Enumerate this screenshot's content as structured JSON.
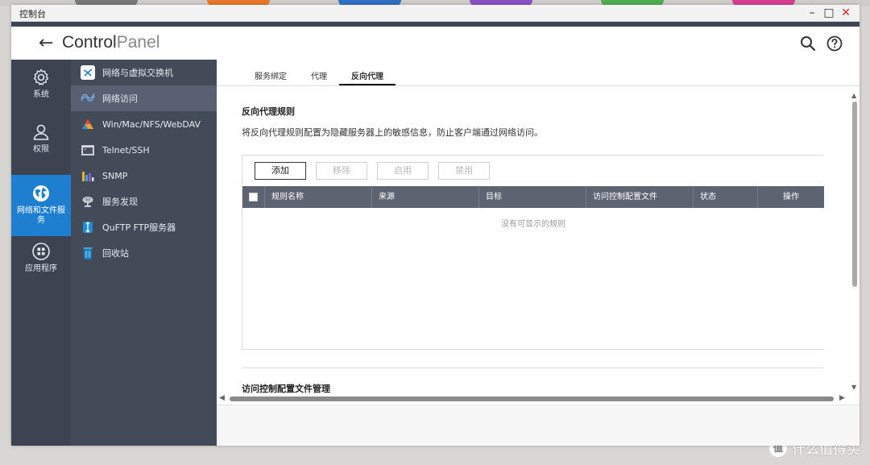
{
  "window": {
    "title": "控制台",
    "minimize": "–",
    "maximize": "□",
    "close": "✕"
  },
  "header": {
    "brand_part1": "Control",
    "brand_part2": "Panel",
    "back_icon": "back-arrow-icon",
    "search_icon": "search-icon",
    "help_icon": "help-icon"
  },
  "rail": {
    "items": [
      {
        "label": "系统",
        "icon": "gear-icon",
        "active": false
      },
      {
        "label": "权限",
        "icon": "user-icon",
        "active": false
      },
      {
        "label": "网络和文件服务",
        "icon": "globe-icon",
        "active": true
      },
      {
        "label": "应用程序",
        "icon": "apps-icon",
        "active": false
      }
    ]
  },
  "submenu": {
    "items": [
      {
        "label": "网络与虚拟交换机",
        "icon": "network-switch-icon",
        "active": false
      },
      {
        "label": "网络访问",
        "icon": "network-access-icon",
        "active": true
      },
      {
        "label": "Win/Mac/NFS/WebDAV",
        "icon": "triangle-icon",
        "active": false
      },
      {
        "label": "Telnet/SSH",
        "icon": "terminal-icon",
        "active": false
      },
      {
        "label": "SNMP",
        "icon": "bar-chart-icon",
        "active": false
      },
      {
        "label": "服务发现",
        "icon": "satellite-icon",
        "active": false
      },
      {
        "label": "QuFTP FTP服务器",
        "icon": "ftp-icon",
        "active": false
      },
      {
        "label": "回收站",
        "icon": "trash-icon",
        "active": false
      }
    ]
  },
  "tabs": [
    {
      "label": "服务绑定",
      "active": false
    },
    {
      "label": "代理",
      "active": false
    },
    {
      "label": "反向代理",
      "active": true
    }
  ],
  "main": {
    "section_title": "反向代理规则",
    "description": "将反向代理规则配置为隐藏服务器上的敏感信息，防止客户端通过网络访问。",
    "buttons": {
      "add": "添加",
      "remove": "移除",
      "enable": "启用",
      "disable": "禁用"
    },
    "table": {
      "columns": [
        "规则名称",
        "来源",
        "目标",
        "访问控制配置文件",
        "状态",
        "操作"
      ],
      "empty_text": "没有可显示的规则"
    },
    "section2_title": "访问控制配置文件管理"
  },
  "watermark": {
    "symbol": "值",
    "text": "什么值得买"
  },
  "colors": {
    "rail_bg": "#3d4351",
    "submenu_bg": "#434a58",
    "accent_blue": "#1e7fd0",
    "table_header": "#5d6371",
    "close_red": "#d9262e"
  }
}
